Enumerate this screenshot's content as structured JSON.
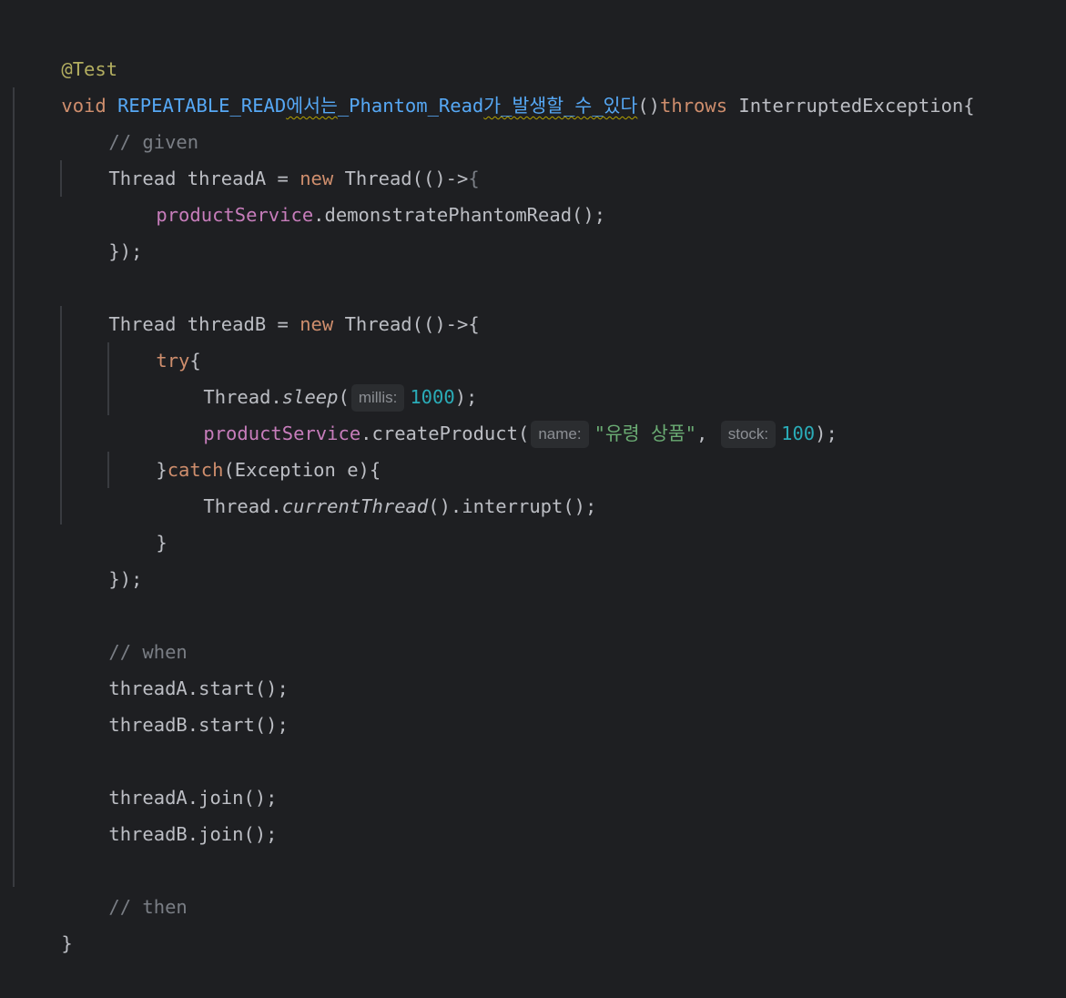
{
  "editor": {
    "line1": {
      "annotation": "@Test"
    },
    "line2": {
      "kw_void": "void ",
      "method_part1": "REPEATABLE_READ",
      "method_part2": "에서는",
      "method_part3": "_Phantom_Read",
      "method_part4": "가_발생할_수_있다",
      "parens": "()",
      "kw_throws": "throws",
      "space": " ",
      "exception": "InterruptedException{"
    },
    "line3": {
      "comment": "// given"
    },
    "line4": {
      "decl": "Thread threadA = ",
      "kw_new": "new",
      "rest": " Thread(()->",
      "brace": "{"
    },
    "line5": {
      "field": "productService",
      "call": ".demonstratePhantomRead();"
    },
    "line6": {
      "text": "});"
    },
    "line8": {
      "decl": "Thread threadB = ",
      "kw_new": "new",
      "rest": " Thread(()->{"
    },
    "line9": {
      "kw_try": "try",
      "brace": "{"
    },
    "line10": {
      "class": "Thread.",
      "method": "sleep",
      "open": "(",
      "hint": "millis:",
      "num": "1000",
      "close": ");"
    },
    "line11": {
      "field": "productService",
      "call": ".createProduct(",
      "hint_name": "name:",
      "str": "\"유령 상품\"",
      "comma": ", ",
      "hint_stock": "stock:",
      "num": "100",
      "close": ");"
    },
    "line12": {
      "brace": "}",
      "kw_catch": "catch",
      "rest": "(Exception e){"
    },
    "line13": {
      "class": "Thread.",
      "method": "currentThread",
      "rest": "().interrupt();"
    },
    "line14": {
      "text": "}"
    },
    "line15": {
      "text": "});"
    },
    "line17": {
      "comment": "// when"
    },
    "line18": {
      "text": "threadA.start();"
    },
    "line19": {
      "text": "threadB.start();"
    },
    "line21": {
      "text": "threadA.join();"
    },
    "line22": {
      "text": "threadB.join();"
    },
    "line24": {
      "comment": "// then"
    },
    "line25": {
      "text": "}"
    }
  },
  "colors": {
    "background": "#1e1f22",
    "default_text": "#bcbec4",
    "annotation": "#b3ae60",
    "keyword": "#cf8e6d",
    "method_declaration": "#56a8f5",
    "comment": "#7a7e85",
    "field": "#c77dbb",
    "number": "#2aacb8",
    "string": "#6aab73",
    "inlay_hint_bg": "#2b2d30",
    "inlay_hint_text": "#8c8f94"
  }
}
